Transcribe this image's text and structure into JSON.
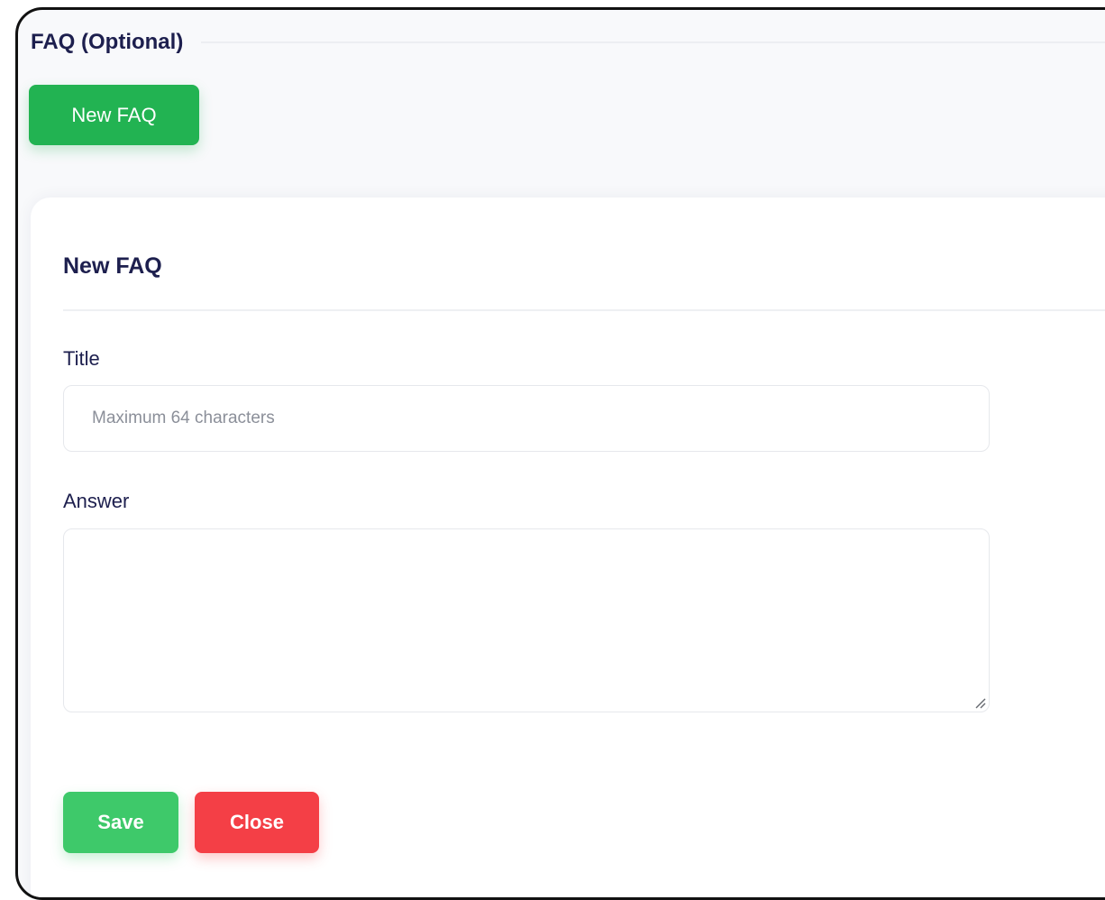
{
  "section": {
    "title": "FAQ (Optional)",
    "new_faq_button": "New FAQ"
  },
  "form": {
    "heading": "New FAQ",
    "title_label": "Title",
    "title_placeholder": "Maximum 64 characters",
    "title_value": "",
    "answer_label": "Answer",
    "answer_value": "",
    "save_label": "Save",
    "close_label": "Close"
  },
  "icons": {
    "resize_grip": "resize-grip-icon"
  },
  "colors": {
    "heading_text": "#1d1f4e",
    "new_faq_button": "#22b352",
    "save_button": "#3ec96a",
    "close_button": "#f43f46"
  }
}
